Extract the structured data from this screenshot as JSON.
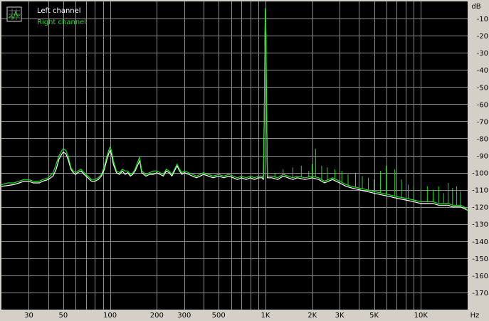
{
  "colors": {
    "background": "#000000",
    "frame": "#d4d0c8",
    "grid": "#8c8c8c",
    "left_channel": "#ffffff",
    "right_channel": "#1fe21f"
  },
  "legend": {
    "icon": "spectrum-icon",
    "placement": "top-left",
    "left_label": "Left channel",
    "right_label": "Right channel"
  },
  "chart_data": {
    "type": "line",
    "title": "",
    "xlabel": "",
    "ylabel": "",
    "x_unit": "Hz",
    "y_unit": "dB",
    "x_scale": "log",
    "xlim": [
      20,
      20000
    ],
    "ylim": [
      -180,
      0
    ],
    "grid": true,
    "x_ticks": [
      {
        "value": 30,
        "label": "30"
      },
      {
        "value": 50,
        "label": "50"
      },
      {
        "value": 100,
        "label": "100"
      },
      {
        "value": 200,
        "label": "200"
      },
      {
        "value": 300,
        "label": "300"
      },
      {
        "value": 500,
        "label": "500"
      },
      {
        "value": 1000,
        "label": "1K"
      },
      {
        "value": 2000,
        "label": "2K"
      },
      {
        "value": 3000,
        "label": "3K"
      },
      {
        "value": 5000,
        "label": "5K"
      },
      {
        "value": 10000,
        "label": "10K"
      }
    ],
    "y_ticks": [
      {
        "value": -10,
        "label": "-10"
      },
      {
        "value": -20,
        "label": "-20"
      },
      {
        "value": -30,
        "label": "-30"
      },
      {
        "value": -40,
        "label": "-40"
      },
      {
        "value": -50,
        "label": "-50"
      },
      {
        "value": -60,
        "label": "-60"
      },
      {
        "value": -70,
        "label": "-70"
      },
      {
        "value": -80,
        "label": "-80"
      },
      {
        "value": -90,
        "label": "-90"
      },
      {
        "value": -100,
        "label": "-100"
      },
      {
        "value": -110,
        "label": "-110"
      },
      {
        "value": -120,
        "label": "-120"
      },
      {
        "value": -130,
        "label": "-130"
      },
      {
        "value": -140,
        "label": "-140"
      },
      {
        "value": -150,
        "label": "-150"
      },
      {
        "value": -160,
        "label": "-160"
      },
      {
        "value": -170,
        "label": "-170"
      }
    ],
    "series": [
      {
        "name": "Left channel",
        "points": [
          [
            20,
            -108
          ],
          [
            22,
            -107.5
          ],
          [
            24,
            -107
          ],
          [
            26,
            -106
          ],
          [
            28,
            -105
          ],
          [
            30,
            -105
          ],
          [
            32,
            -106
          ],
          [
            35,
            -106
          ],
          [
            37,
            -105
          ],
          [
            40,
            -104
          ],
          [
            43,
            -102
          ],
          [
            45,
            -98
          ],
          [
            47,
            -92
          ],
          [
            49,
            -89
          ],
          [
            50,
            -88
          ],
          [
            52,
            -89
          ],
          [
            54,
            -93
          ],
          [
            56,
            -98
          ],
          [
            58,
            -100
          ],
          [
            60,
            -101
          ],
          [
            62,
            -100
          ],
          [
            65,
            -99
          ],
          [
            68,
            -101
          ],
          [
            72,
            -103
          ],
          [
            76,
            -105
          ],
          [
            80,
            -105
          ],
          [
            84,
            -104
          ],
          [
            88,
            -102
          ],
          [
            92,
            -98
          ],
          [
            95,
            -93
          ],
          [
            98,
            -89
          ],
          [
            100,
            -87
          ],
          [
            102,
            -89
          ],
          [
            105,
            -95
          ],
          [
            110,
            -100
          ],
          [
            115,
            -101
          ],
          [
            120,
            -99
          ],
          [
            125,
            -101
          ],
          [
            130,
            -100
          ],
          [
            135,
            -102
          ],
          [
            140,
            -101
          ],
          [
            145,
            -99
          ],
          [
            150,
            -96
          ],
          [
            155,
            -93
          ],
          [
            160,
            -100
          ],
          [
            170,
            -102
          ],
          [
            180,
            -101
          ],
          [
            190,
            -101
          ],
          [
            200,
            -100
          ],
          [
            210,
            -101
          ],
          [
            220,
            -102
          ],
          [
            230,
            -99
          ],
          [
            240,
            -100
          ],
          [
            250,
            -102
          ],
          [
            260,
            -99
          ],
          [
            270,
            -96
          ],
          [
            280,
            -99
          ],
          [
            290,
            -101
          ],
          [
            300,
            -100
          ],
          [
            320,
            -101
          ],
          [
            340,
            -102
          ],
          [
            360,
            -103
          ],
          [
            380,
            -102
          ],
          [
            400,
            -101
          ],
          [
            430,
            -102
          ],
          [
            460,
            -103
          ],
          [
            500,
            -102
          ],
          [
            540,
            -103
          ],
          [
            580,
            -102
          ],
          [
            620,
            -103
          ],
          [
            660,
            -104
          ],
          [
            700,
            -103
          ],
          [
            750,
            -104
          ],
          [
            800,
            -103
          ],
          [
            850,
            -104
          ],
          [
            900,
            -103
          ],
          [
            950,
            -103
          ],
          [
            970,
            -104
          ],
          [
            985,
            -60
          ],
          [
            993,
            -20
          ],
          [
            1000,
            -5
          ],
          [
            1007,
            -20
          ],
          [
            1015,
            -60
          ],
          [
            1030,
            -103
          ],
          [
            1100,
            -103
          ],
          [
            1200,
            -104
          ],
          [
            1300,
            -102
          ],
          [
            1400,
            -103
          ],
          [
            1500,
            -104
          ],
          [
            1600,
            -103
          ],
          [
            1800,
            -104
          ],
          [
            2000,
            -103
          ],
          [
            2200,
            -104
          ],
          [
            2400,
            -106
          ],
          [
            2700,
            -104
          ],
          [
            3000,
            -106
          ],
          [
            3300,
            -108
          ],
          [
            3600,
            -109
          ],
          [
            4000,
            -110
          ],
          [
            4500,
            -111
          ],
          [
            5000,
            -112
          ],
          [
            5600,
            -113
          ],
          [
            6300,
            -114
          ],
          [
            7000,
            -115
          ],
          [
            8000,
            -116
          ],
          [
            9000,
            -117
          ],
          [
            10000,
            -118
          ],
          [
            11000,
            -118
          ],
          [
            12000,
            -118
          ],
          [
            13000,
            -119
          ],
          [
            14000,
            -119
          ],
          [
            15000,
            -119
          ],
          [
            16000,
            -120
          ],
          [
            17000,
            -120
          ],
          [
            18000,
            -120
          ],
          [
            19000,
            -121
          ],
          [
            20000,
            -122
          ]
        ]
      },
      {
        "name": "Right channel",
        "points": [
          [
            20,
            -107
          ],
          [
            22,
            -106
          ],
          [
            24,
            -106
          ],
          [
            26,
            -105
          ],
          [
            28,
            -104
          ],
          [
            30,
            -104
          ],
          [
            32,
            -105
          ],
          [
            35,
            -105
          ],
          [
            37,
            -104
          ],
          [
            40,
            -103
          ],
          [
            43,
            -100
          ],
          [
            45,
            -95
          ],
          [
            47,
            -90
          ],
          [
            49,
            -87
          ],
          [
            50,
            -86
          ],
          [
            52,
            -87
          ],
          [
            54,
            -91
          ],
          [
            56,
            -97
          ],
          [
            58,
            -99
          ],
          [
            60,
            -100
          ],
          [
            62,
            -99
          ],
          [
            65,
            -98
          ],
          [
            68,
            -100
          ],
          [
            72,
            -102
          ],
          [
            76,
            -104
          ],
          [
            80,
            -104
          ],
          [
            84,
            -103
          ],
          [
            88,
            -101
          ],
          [
            92,
            -96
          ],
          [
            95,
            -91
          ],
          [
            98,
            -87
          ],
          [
            100,
            -85
          ],
          [
            102,
            -87
          ],
          [
            105,
            -93
          ],
          [
            110,
            -99
          ],
          [
            115,
            -100
          ],
          [
            120,
            -98
          ],
          [
            125,
            -99
          ],
          [
            130,
            -99
          ],
          [
            135,
            -101
          ],
          [
            140,
            -100
          ],
          [
            145,
            -98
          ],
          [
            150,
            -94
          ],
          [
            155,
            -91
          ],
          [
            160,
            -99
          ],
          [
            170,
            -101
          ],
          [
            180,
            -100
          ],
          [
            190,
            -99
          ],
          [
            200,
            -99
          ],
          [
            210,
            -100
          ],
          [
            220,
            -101
          ],
          [
            230,
            -98
          ],
          [
            240,
            -99
          ],
          [
            250,
            -101
          ],
          [
            260,
            -98
          ],
          [
            270,
            -95
          ],
          [
            280,
            -98
          ],
          [
            290,
            -100
          ],
          [
            300,
            -99
          ],
          [
            320,
            -100
          ],
          [
            340,
            -101
          ],
          [
            360,
            -102
          ],
          [
            380,
            -101
          ],
          [
            400,
            -100
          ],
          [
            430,
            -101
          ],
          [
            460,
            -102
          ],
          [
            500,
            -101
          ],
          [
            540,
            -102
          ],
          [
            580,
            -101
          ],
          [
            620,
            -102
          ],
          [
            660,
            -103
          ],
          [
            700,
            -102
          ],
          [
            750,
            -103
          ],
          [
            800,
            -102
          ],
          [
            850,
            -103
          ],
          [
            900,
            -102
          ],
          [
            950,
            -102
          ],
          [
            970,
            -103
          ],
          [
            985,
            -58
          ],
          [
            993,
            -18
          ],
          [
            1000,
            -4
          ],
          [
            1007,
            -18
          ],
          [
            1015,
            -58
          ],
          [
            1030,
            -102
          ],
          [
            1100,
            -102
          ],
          [
            1200,
            -103
          ],
          [
            1300,
            -101
          ],
          [
            1400,
            -102
          ],
          [
            1500,
            -103
          ],
          [
            1600,
            -102
          ],
          [
            1800,
            -103
          ],
          [
            2000,
            -102
          ],
          [
            2200,
            -103
          ],
          [
            2400,
            -105
          ],
          [
            2700,
            -103
          ],
          [
            3000,
            -105
          ],
          [
            3300,
            -107
          ],
          [
            3600,
            -108
          ],
          [
            4000,
            -109
          ],
          [
            4500,
            -110
          ],
          [
            5000,
            -111
          ],
          [
            5600,
            -112
          ],
          [
            6300,
            -113
          ],
          [
            7000,
            -114
          ],
          [
            8000,
            -115
          ],
          [
            9000,
            -116
          ],
          [
            10000,
            -117
          ],
          [
            11000,
            -117
          ],
          [
            12000,
            -117
          ],
          [
            13000,
            -118
          ],
          [
            14000,
            -118
          ],
          [
            15000,
            -118
          ],
          [
            16000,
            -119
          ],
          [
            17000,
            -119
          ],
          [
            18000,
            -119
          ],
          [
            19000,
            -120
          ],
          [
            20000,
            -122
          ]
        ],
        "spurs": [
          [
            1150,
            -100
          ],
          [
            1300,
            -98
          ],
          [
            1500,
            -97
          ],
          [
            1700,
            -96
          ],
          [
            1900,
            -99
          ],
          [
            2000,
            -95
          ],
          [
            2100,
            -86
          ],
          [
            2300,
            -96
          ],
          [
            2500,
            -97
          ],
          [
            2800,
            -98
          ],
          [
            3100,
            -99
          ],
          [
            3400,
            -101
          ],
          [
            3800,
            -100
          ],
          [
            4200,
            -102
          ],
          [
            4600,
            -103
          ],
          [
            5000,
            -104
          ],
          [
            5500,
            -99
          ],
          [
            6000,
            -96
          ],
          [
            6800,
            -98
          ],
          [
            7500,
            -104
          ],
          [
            8300,
            -107
          ],
          [
            9000,
            -108
          ],
          [
            10000,
            -110
          ],
          [
            11000,
            -108
          ],
          [
            12000,
            -110
          ],
          [
            13000,
            -108
          ],
          [
            14000,
            -112
          ],
          [
            15000,
            -106
          ],
          [
            16000,
            -109
          ],
          [
            17000,
            -108
          ],
          [
            18000,
            -111
          ]
        ]
      }
    ]
  }
}
